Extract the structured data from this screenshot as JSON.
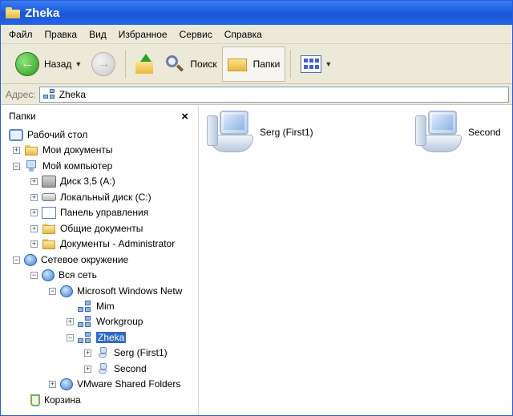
{
  "window": {
    "title": "Zheka"
  },
  "menu": [
    "Файл",
    "Правка",
    "Вид",
    "Избранное",
    "Сервис",
    "Справка"
  ],
  "toolbar": {
    "back_label": "Назад",
    "search_label": "Поиск",
    "folders_label": "Папки"
  },
  "address": {
    "label": "Адрес:",
    "value": "Zheka"
  },
  "folders_pane": {
    "title": "Папки",
    "close": "×"
  },
  "tree": {
    "desktop": "Рабочий стол",
    "my_docs": "Мои документы",
    "my_computer": "Мой компьютер",
    "floppy": "Диск 3,5 (A:)",
    "local_disk": "Локальный диск (C:)",
    "control_panel": "Панель управления",
    "shared_docs": "Общие документы",
    "admin_docs": "Документы - Administrator",
    "network": "Сетевое окружение",
    "entire_network": "Вся сеть",
    "ms_windows_network": "Microsoft Windows Netw",
    "mim": "Mim",
    "workgroup": "Workgroup",
    "zheka": "Zheka",
    "serg": "Serg (First1)",
    "second": "Second",
    "vmware": "VMware Shared Folders",
    "recycle": "Корзина"
  },
  "content": {
    "items": [
      {
        "label": "Serg (First1)",
        "icon": "computer-icon"
      },
      {
        "label": "Second",
        "icon": "computer-icon"
      }
    ]
  }
}
